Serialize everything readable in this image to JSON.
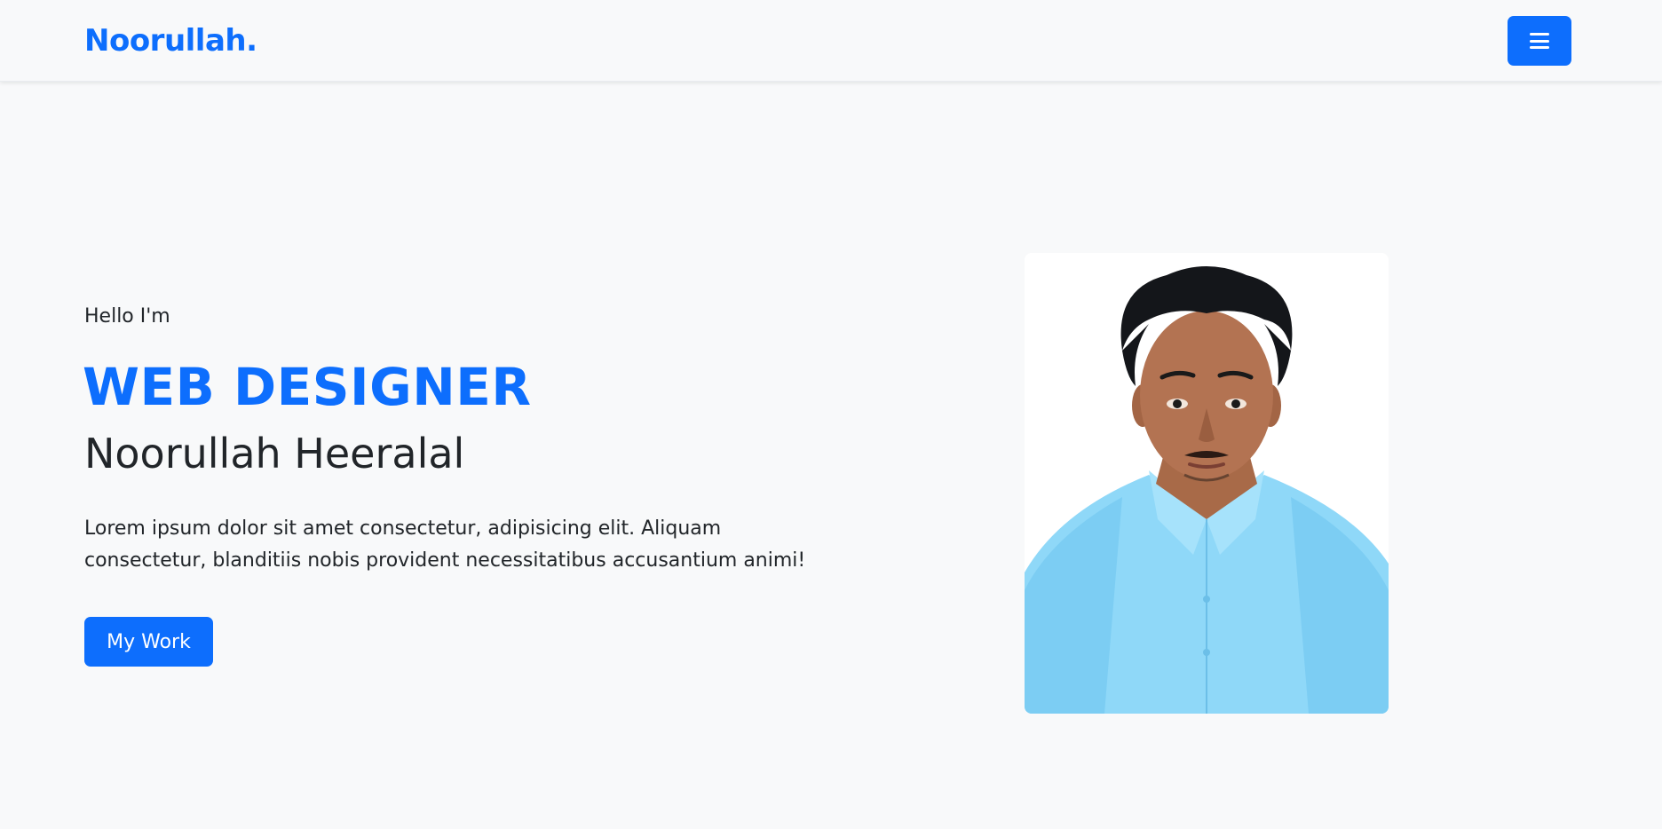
{
  "nav": {
    "brand": "Noorullah.",
    "menu_icon": "hamburger-menu-icon",
    "accent": "#0d6efd"
  },
  "hero": {
    "greeting": "Hello I'm",
    "role": "WEB DESIGNER",
    "name": "Noorullah Heeralal",
    "description": "Lorem ipsum dolor sit amet consectetur, adipisicing elit. Aliquam consectetur, blanditiis nobis provident necessitatibus accusantium animi!",
    "cta_label": "My Work"
  },
  "photo": {
    "alt": "portrait"
  }
}
